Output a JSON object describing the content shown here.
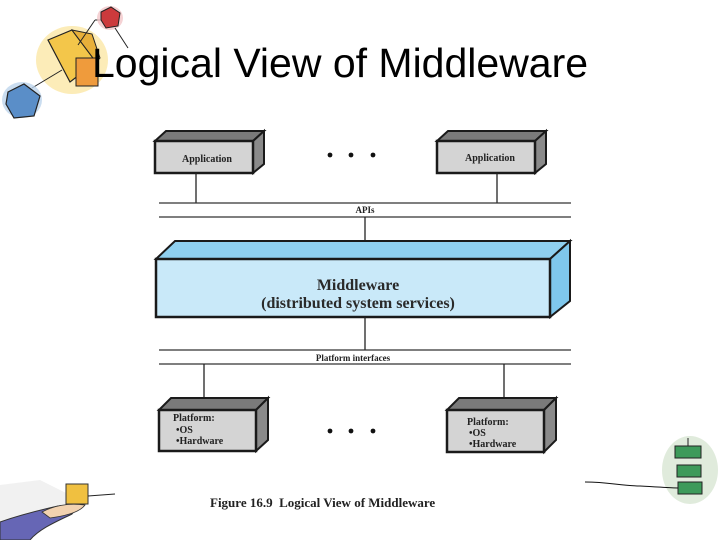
{
  "slide": {
    "title": "Logical View of Middleware"
  },
  "diagram": {
    "applications": [
      {
        "label": "Application"
      },
      {
        "label": "Application"
      }
    ],
    "app_ellipsis": "• • •",
    "api_label": "APIs",
    "middleware": {
      "line1": "Middleware",
      "line2": "(distributed system services)"
    },
    "platform_interface_label": "Platform interfaces",
    "platforms": [
      {
        "title": "Platform:",
        "items": [
          "•OS",
          "•Hardware"
        ]
      },
      {
        "title": "Platform:",
        "items": [
          "•OS",
          "•Hardware"
        ]
      }
    ],
    "platform_ellipsis": "• • •",
    "caption": "Figure 16.9  Logical View of Middleware",
    "colors": {
      "middleware_front": "#c9e9f9",
      "middleware_top": "#8fd0f0",
      "middleware_side": "#7fc7ec",
      "box_front": "#d4d4d4",
      "box_top": "#7a7a7a",
      "box_side": "#8a8a8a",
      "stroke": "#1a1a1a"
    }
  }
}
